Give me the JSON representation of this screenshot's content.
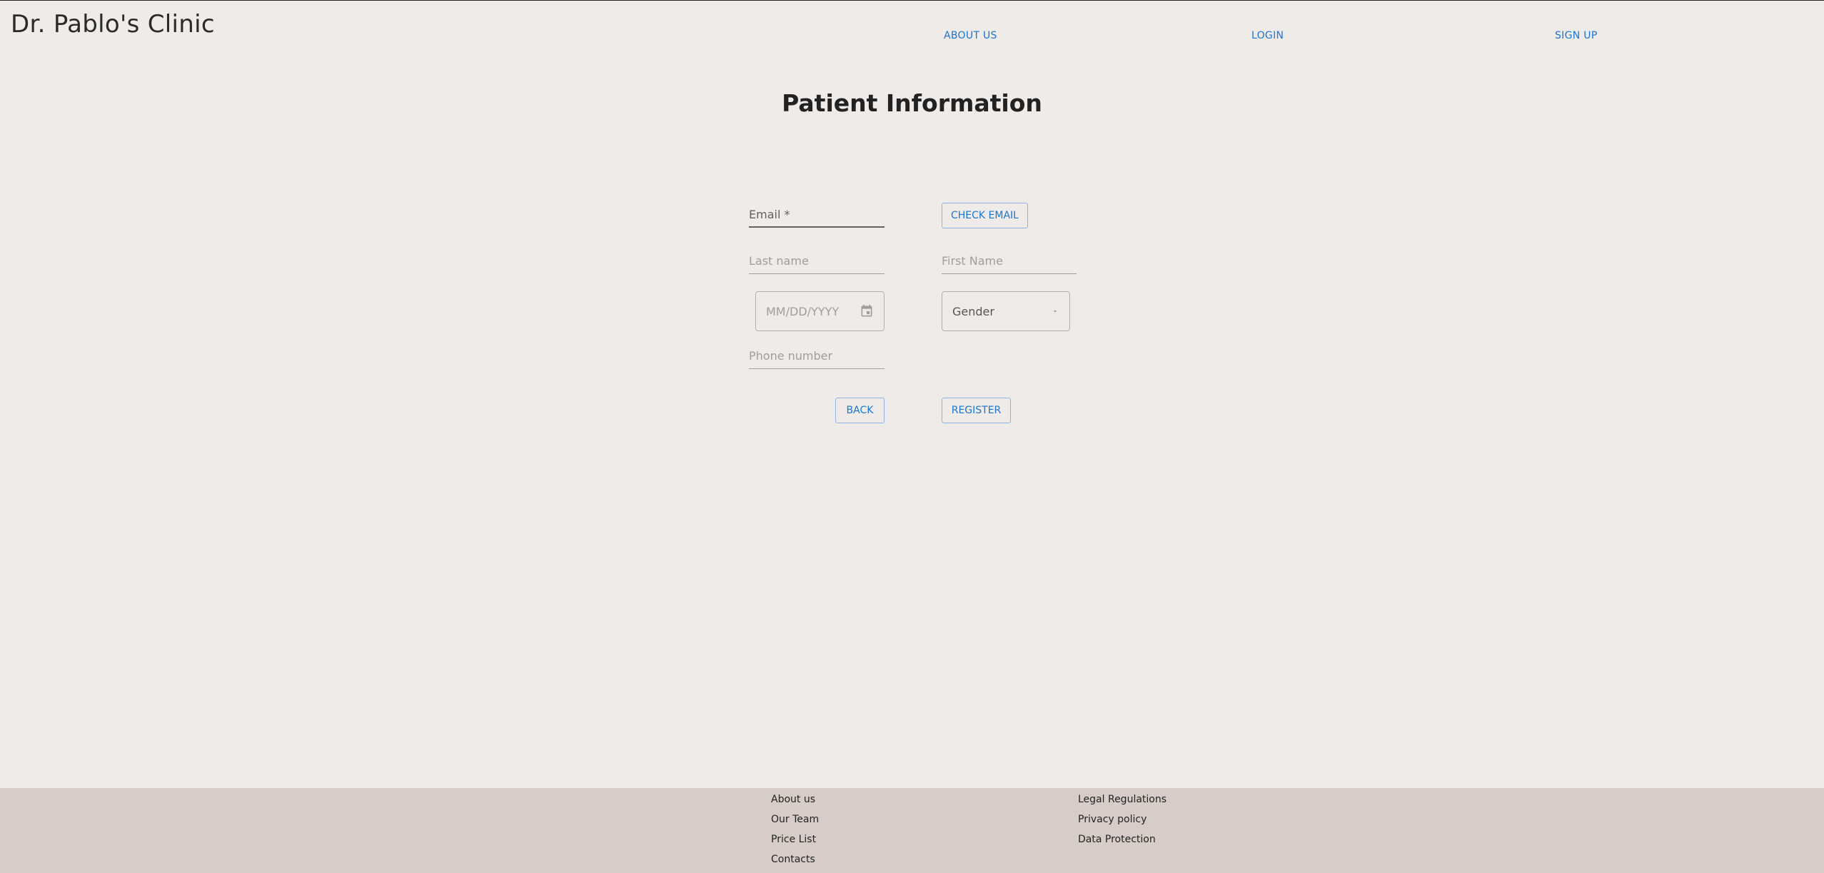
{
  "header": {
    "brand": "Dr. Pablo's Clinic",
    "nav": {
      "about": "ABOUT US",
      "login": "LOGIN",
      "signup": "SIGN UP"
    }
  },
  "main": {
    "title": "Patient Information",
    "form": {
      "email_label": "Email *",
      "check_email_label": "CHECK EMAIL",
      "last_name_placeholder": "Last name",
      "first_name_placeholder": "First Name",
      "dob_placeholder": "MM/DD/YYYY",
      "gender_label": "Gender",
      "phone_placeholder": "Phone number",
      "back_label": "BACK",
      "register_label": "REGISTER"
    }
  },
  "footer": {
    "col1": [
      "About us",
      "Our Team",
      "Price List",
      "Contacts"
    ],
    "col2": [
      "Legal Regulations",
      "Privacy policy",
      "Data Protection"
    ]
  },
  "colors": {
    "background": "#efebe9",
    "footer": "#d7ccc8",
    "accent": "#1976d2"
  },
  "icons": {
    "calendar": "calendar-icon",
    "dropdown": "chevron-down-icon"
  }
}
